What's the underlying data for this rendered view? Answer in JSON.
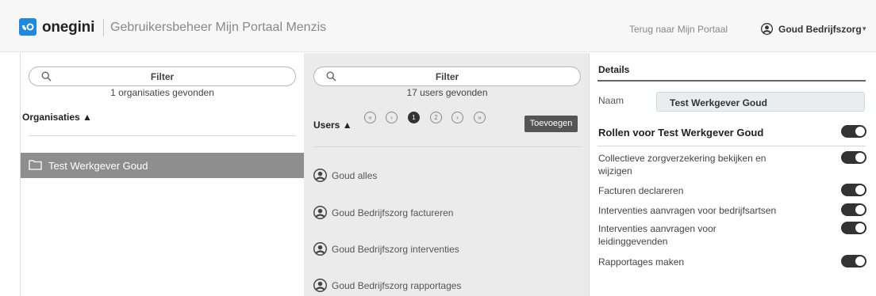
{
  "header": {
    "logo_text": "onegini",
    "app_title": "Gebruikersbeheer Mijn Portaal Menzis",
    "back_link": "Terug naar Mijn Portaal",
    "user_name": "Goud Bedrijfszorg",
    "user_caret": "▾",
    "brand_color": "#1e88e5"
  },
  "organisations": {
    "search_placeholder": "Filter",
    "found_text": "1 organisaties gevonden",
    "section_label": "Organisaties ▲",
    "items": [
      {
        "label": "Test Werkgever Goud",
        "selected": true
      }
    ]
  },
  "users": {
    "search_placeholder": "Filter",
    "found_text": "17 users gevonden",
    "section_label": "Users ▲",
    "pagination": [
      "«",
      "‹",
      "1",
      "2",
      "›",
      "»"
    ],
    "current_page": "1",
    "add_button": "Toevoegen",
    "items": [
      {
        "label": "Goud alles"
      },
      {
        "label": "Goud Bedrijfszorg factureren"
      },
      {
        "label": "Goud Bedrijfszorg interventies"
      },
      {
        "label": "Goud Bedrijfszorg rapportages"
      }
    ]
  },
  "details": {
    "title": "Details",
    "naam_label": "Naam",
    "naam_value": "Test Werkgever Goud",
    "roles_title": "Rollen voor Test Werkgever Goud",
    "roles_toggle_on": true,
    "permissions": [
      {
        "label": "Collectieve zorgverzekering bekijken en wijzigen",
        "enabled": true
      },
      {
        "label": "Facturen declareren",
        "enabled": true
      },
      {
        "label": "Interventies aanvragen voor bedrijfsartsen",
        "enabled": true
      },
      {
        "label": "Interventies aanvragen voor leidinggevenden",
        "enabled": true
      },
      {
        "label": "Rapportages maken",
        "enabled": true
      }
    ]
  }
}
